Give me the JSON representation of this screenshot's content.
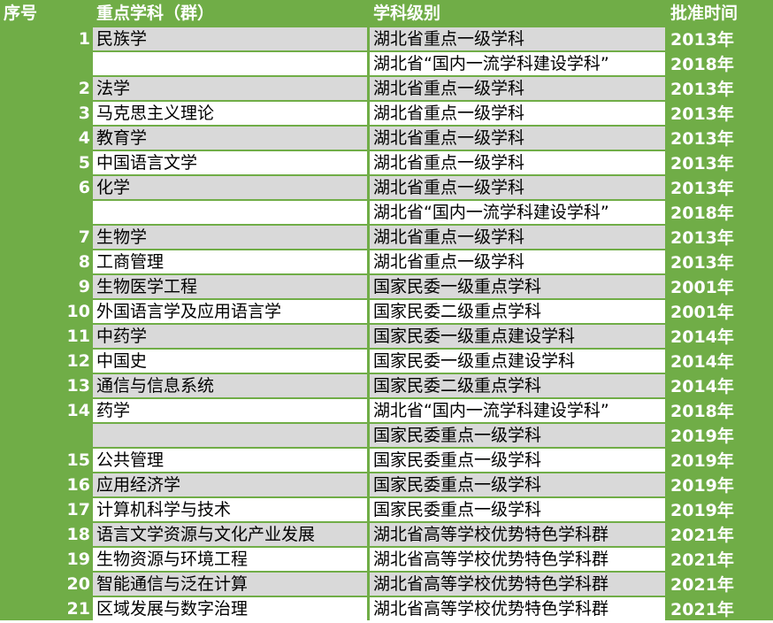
{
  "header": {
    "seq": "序号",
    "name": "重点学科（群）",
    "level": "学科级别",
    "time": "批准时间"
  },
  "rows": [
    {
      "seq": "1",
      "name": "民族学",
      "level": "湖北省重点一级学科",
      "time": "2013年"
    },
    {
      "seq": "",
      "name": "",
      "level": "湖北省“国内一流学科建设学科”",
      "time": "2018年"
    },
    {
      "seq": "2",
      "name": "法学",
      "level": "湖北省重点一级学科",
      "time": "2013年"
    },
    {
      "seq": "3",
      "name": "马克思主义理论",
      "level": "湖北省重点一级学科",
      "time": "2013年"
    },
    {
      "seq": "4",
      "name": "教育学",
      "level": "湖北省重点一级学科",
      "time": "2013年"
    },
    {
      "seq": "5",
      "name": "中国语言文学",
      "level": "湖北省重点一级学科",
      "time": "2013年"
    },
    {
      "seq": "6",
      "name": "化学",
      "level": "湖北省重点一级学科",
      "time": "2013年"
    },
    {
      "seq": "",
      "name": "",
      "level": "湖北省“国内一流学科建设学科”",
      "time": "2018年"
    },
    {
      "seq": "7",
      "name": "生物学",
      "level": "湖北省重点一级学科",
      "time": "2013年"
    },
    {
      "seq": "8",
      "name": "工商管理",
      "level": "湖北省重点一级学科",
      "time": "2013年"
    },
    {
      "seq": "9",
      "name": "生物医学工程",
      "level": "国家民委一级重点学科",
      "time": "2001年"
    },
    {
      "seq": "10",
      "name": "外国语言学及应用语言学",
      "level": "国家民委二级重点学科",
      "time": "2001年"
    },
    {
      "seq": "11",
      "name": "中药学",
      "level": "国家民委一级重点建设学科",
      "time": "2014年"
    },
    {
      "seq": "12",
      "name": "中国史",
      "level": "国家民委一级重点建设学科",
      "time": "2014年"
    },
    {
      "seq": "13",
      "name": "通信与信息系统",
      "level": "国家民委二级重点学科",
      "time": "2014年"
    },
    {
      "seq": "14",
      "name": "药学",
      "level": "湖北省“国内一流学科建设学科”",
      "time": "2018年"
    },
    {
      "seq": "",
      "name": "",
      "level": "国家民委重点一级学科",
      "time": "2019年"
    },
    {
      "seq": "15",
      "name": "公共管理",
      "level": "国家民委重点一级学科",
      "time": "2019年"
    },
    {
      "seq": "16",
      "name": "应用经济学",
      "level": "国家民委重点一级学科",
      "time": "2019年"
    },
    {
      "seq": "17",
      "name": "计算机科学与技术",
      "level": "国家民委重点一级学科",
      "time": "2019年"
    },
    {
      "seq": "18",
      "name": "语言文学资源与文化产业发展",
      "level": "湖北省高等学校优势特色学科群",
      "time": "2021年"
    },
    {
      "seq": "19",
      "name": "生物资源与环境工程",
      "level": "湖北省高等学校优势特色学科群",
      "time": "2021年"
    },
    {
      "seq": "20",
      "name": "智能通信与泛在计算",
      "level": "湖北省高等学校优势特色学科群",
      "time": "2021年"
    },
    {
      "seq": "21",
      "name": "区域发展与数字治理",
      "level": "湖北省高等学校优势特色学科群",
      "time": "2021年"
    }
  ]
}
